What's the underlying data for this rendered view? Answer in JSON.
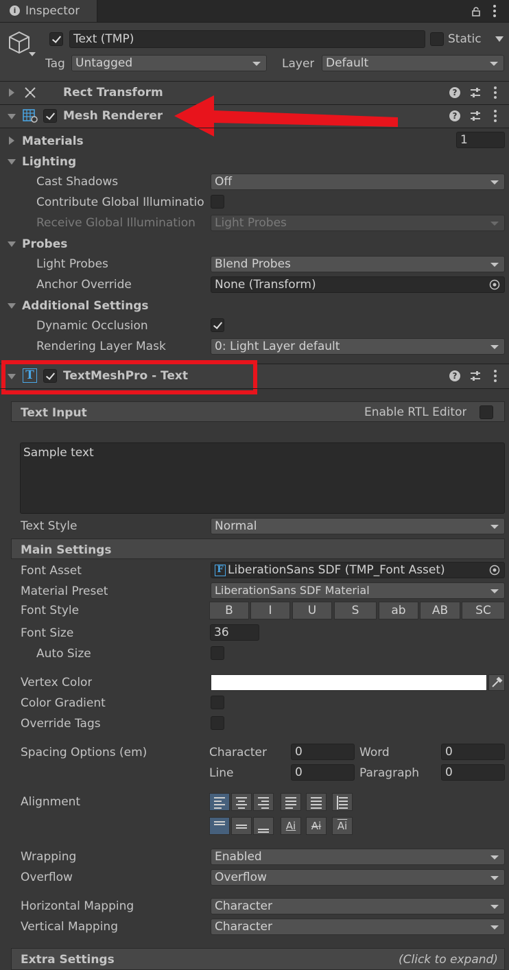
{
  "tab": {
    "title": "Inspector"
  },
  "object": {
    "name": "Text (TMP)",
    "static_label": "Static",
    "tag_label": "Tag",
    "tag_value": "Untagged",
    "layer_label": "Layer",
    "layer_value": "Default"
  },
  "rect_transform": {
    "title": "Rect Transform"
  },
  "mesh_renderer": {
    "title": "Mesh Renderer",
    "materials_label": "Materials",
    "materials_count": "1",
    "lighting_label": "Lighting",
    "cast_shadows_label": "Cast Shadows",
    "cast_shadows_value": "Off",
    "contribute_gi_label": "Contribute Global Illuminatio",
    "receive_gi_label": "Receive Global Illumination",
    "receive_gi_value": "Light Probes",
    "probes_label": "Probes",
    "light_probes_label": "Light Probes",
    "light_probes_value": "Blend Probes",
    "anchor_override_label": "Anchor Override",
    "anchor_override_value": "None (Transform)",
    "additional_label": "Additional Settings",
    "dynamic_occlusion_label": "Dynamic Occlusion",
    "rendering_layer_label": "Rendering Layer Mask",
    "rendering_layer_value": "0: Light Layer default"
  },
  "tmp": {
    "title": "TextMeshPro - Text",
    "text_input_label": "Text Input",
    "rtl_label": "Enable RTL Editor",
    "text_value": "Sample text",
    "text_style_label": "Text Style",
    "text_style_value": "Normal",
    "main_settings_label": "Main Settings",
    "font_asset_label": "Font Asset",
    "font_asset_value": "LiberationSans SDF (TMP_Font Asset)",
    "material_preset_label": "Material Preset",
    "material_preset_value": "LiberationSans SDF Material",
    "font_style_label": "Font Style",
    "font_style_buttons": [
      "B",
      "I",
      "U",
      "S",
      "ab",
      "AB",
      "SC"
    ],
    "font_size_label": "Font Size",
    "font_size_value": "36",
    "auto_size_label": "Auto Size",
    "vertex_color_label": "Vertex Color",
    "vertex_color": "#ffffff",
    "color_gradient_label": "Color Gradient",
    "override_tags_label": "Override Tags",
    "spacing_label": "Spacing Options (em)",
    "character_label": "Character",
    "character_value": "0",
    "word_label": "Word",
    "word_value": "0",
    "line_label": "Line",
    "line_value": "0",
    "paragraph_label": "Paragraph",
    "paragraph_value": "0",
    "alignment_label": "Alignment",
    "wrapping_label": "Wrapping",
    "wrapping_value": "Enabled",
    "overflow_label": "Overflow",
    "overflow_value": "Overflow",
    "hmap_label": "Horizontal Mapping",
    "hmap_value": "Character",
    "vmap_label": "Vertical Mapping",
    "vmap_value": "Character",
    "extra_label": "Extra Settings",
    "extra_hint": "(Click to expand)"
  },
  "colors": {
    "annotation": "#e8141c",
    "selected_align": "#46607c"
  }
}
